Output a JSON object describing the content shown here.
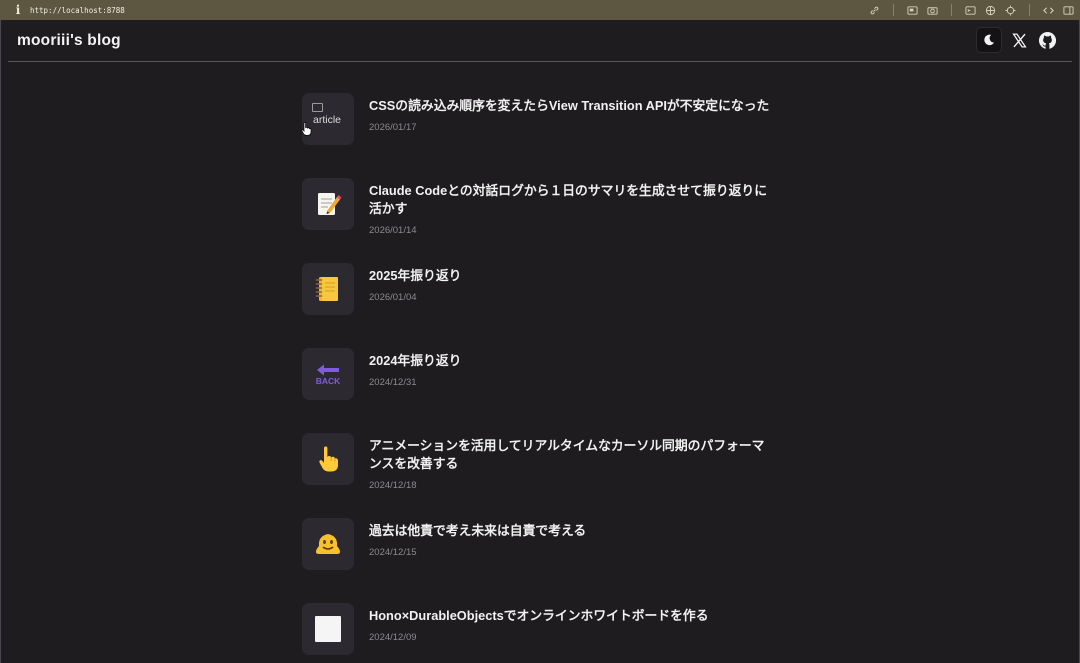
{
  "browser": {
    "url": "http://localhost:8788",
    "info": "i"
  },
  "site": {
    "title": "mooriii's blog"
  },
  "header_icons": [
    "moon-icon",
    "x-logo-icon",
    "github-icon"
  ],
  "articles": [
    {
      "title": "CSSの読み込み順序を変えたらView Transition APIが不安定になった",
      "date": "2026/01/17",
      "thumb": "broken-image",
      "thumb_alt": "article"
    },
    {
      "title": "Claude Codeとの対話ログから１日のサマリを生成させて振り返りに活かす",
      "date": "2026/01/14",
      "thumb": "memo-emoji"
    },
    {
      "title": "2025年振り返り",
      "date": "2026/01/04",
      "thumb": "notebook-emoji"
    },
    {
      "title": "2024年振り返り",
      "date": "2024/12/31",
      "thumb": "back-arrow-emoji",
      "thumb_text": "BACK"
    },
    {
      "title": "アニメーションを活用してリアルタイムなカーソル同期のパフォーマンスを改善する",
      "date": "2024/12/18",
      "thumb": "pointing-hand-emoji"
    },
    {
      "title": "過去は他責で考え未来は自責で考える",
      "date": "2024/12/15",
      "thumb": "melting-face-emoji"
    },
    {
      "title": "Hono×DurableObjectsでオンラインホワイトボードを作る",
      "date": "2024/12/09",
      "thumb": "white-square-emoji"
    }
  ]
}
